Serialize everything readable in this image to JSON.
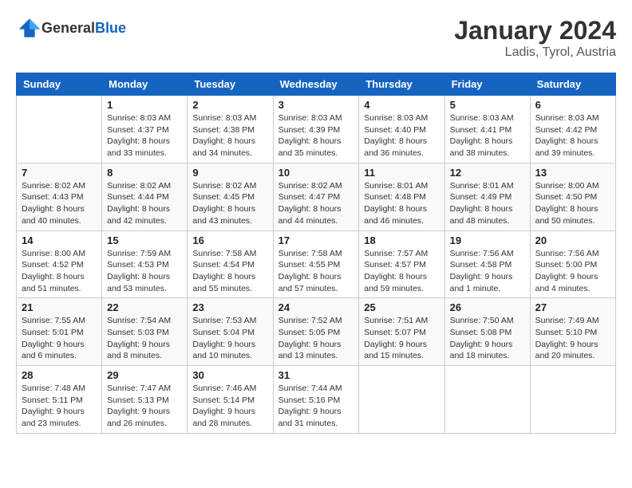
{
  "logo": {
    "text_general": "General",
    "text_blue": "Blue"
  },
  "header": {
    "month": "January 2024",
    "location": "Ladis, Tyrol, Austria"
  },
  "weekdays": [
    "Sunday",
    "Monday",
    "Tuesday",
    "Wednesday",
    "Thursday",
    "Friday",
    "Saturday"
  ],
  "weeks": [
    [
      {
        "day": "",
        "sunrise": "",
        "sunset": "",
        "daylight": ""
      },
      {
        "day": "1",
        "sunrise": "Sunrise: 8:03 AM",
        "sunset": "Sunset: 4:37 PM",
        "daylight": "Daylight: 8 hours and 33 minutes."
      },
      {
        "day": "2",
        "sunrise": "Sunrise: 8:03 AM",
        "sunset": "Sunset: 4:38 PM",
        "daylight": "Daylight: 8 hours and 34 minutes."
      },
      {
        "day": "3",
        "sunrise": "Sunrise: 8:03 AM",
        "sunset": "Sunset: 4:39 PM",
        "daylight": "Daylight: 8 hours and 35 minutes."
      },
      {
        "day": "4",
        "sunrise": "Sunrise: 8:03 AM",
        "sunset": "Sunset: 4:40 PM",
        "daylight": "Daylight: 8 hours and 36 minutes."
      },
      {
        "day": "5",
        "sunrise": "Sunrise: 8:03 AM",
        "sunset": "Sunset: 4:41 PM",
        "daylight": "Daylight: 8 hours and 38 minutes."
      },
      {
        "day": "6",
        "sunrise": "Sunrise: 8:03 AM",
        "sunset": "Sunset: 4:42 PM",
        "daylight": "Daylight: 8 hours and 39 minutes."
      }
    ],
    [
      {
        "day": "7",
        "sunrise": "Sunrise: 8:02 AM",
        "sunset": "Sunset: 4:43 PM",
        "daylight": "Daylight: 8 hours and 40 minutes."
      },
      {
        "day": "8",
        "sunrise": "Sunrise: 8:02 AM",
        "sunset": "Sunset: 4:44 PM",
        "daylight": "Daylight: 8 hours and 42 minutes."
      },
      {
        "day": "9",
        "sunrise": "Sunrise: 8:02 AM",
        "sunset": "Sunset: 4:45 PM",
        "daylight": "Daylight: 8 hours and 43 minutes."
      },
      {
        "day": "10",
        "sunrise": "Sunrise: 8:02 AM",
        "sunset": "Sunset: 4:47 PM",
        "daylight": "Daylight: 8 hours and 44 minutes."
      },
      {
        "day": "11",
        "sunrise": "Sunrise: 8:01 AM",
        "sunset": "Sunset: 4:48 PM",
        "daylight": "Daylight: 8 hours and 46 minutes."
      },
      {
        "day": "12",
        "sunrise": "Sunrise: 8:01 AM",
        "sunset": "Sunset: 4:49 PM",
        "daylight": "Daylight: 8 hours and 48 minutes."
      },
      {
        "day": "13",
        "sunrise": "Sunrise: 8:00 AM",
        "sunset": "Sunset: 4:50 PM",
        "daylight": "Daylight: 8 hours and 50 minutes."
      }
    ],
    [
      {
        "day": "14",
        "sunrise": "Sunrise: 8:00 AM",
        "sunset": "Sunset: 4:52 PM",
        "daylight": "Daylight: 8 hours and 51 minutes."
      },
      {
        "day": "15",
        "sunrise": "Sunrise: 7:59 AM",
        "sunset": "Sunset: 4:53 PM",
        "daylight": "Daylight: 8 hours and 53 minutes."
      },
      {
        "day": "16",
        "sunrise": "Sunrise: 7:58 AM",
        "sunset": "Sunset: 4:54 PM",
        "daylight": "Daylight: 8 hours and 55 minutes."
      },
      {
        "day": "17",
        "sunrise": "Sunrise: 7:58 AM",
        "sunset": "Sunset: 4:55 PM",
        "daylight": "Daylight: 8 hours and 57 minutes."
      },
      {
        "day": "18",
        "sunrise": "Sunrise: 7:57 AM",
        "sunset": "Sunset: 4:57 PM",
        "daylight": "Daylight: 8 hours and 59 minutes."
      },
      {
        "day": "19",
        "sunrise": "Sunrise: 7:56 AM",
        "sunset": "Sunset: 4:58 PM",
        "daylight": "Daylight: 9 hours and 1 minute."
      },
      {
        "day": "20",
        "sunrise": "Sunrise: 7:56 AM",
        "sunset": "Sunset: 5:00 PM",
        "daylight": "Daylight: 9 hours and 4 minutes."
      }
    ],
    [
      {
        "day": "21",
        "sunrise": "Sunrise: 7:55 AM",
        "sunset": "Sunset: 5:01 PM",
        "daylight": "Daylight: 9 hours and 6 minutes."
      },
      {
        "day": "22",
        "sunrise": "Sunrise: 7:54 AM",
        "sunset": "Sunset: 5:03 PM",
        "daylight": "Daylight: 9 hours and 8 minutes."
      },
      {
        "day": "23",
        "sunrise": "Sunrise: 7:53 AM",
        "sunset": "Sunset: 5:04 PM",
        "daylight": "Daylight: 9 hours and 10 minutes."
      },
      {
        "day": "24",
        "sunrise": "Sunrise: 7:52 AM",
        "sunset": "Sunset: 5:05 PM",
        "daylight": "Daylight: 9 hours and 13 minutes."
      },
      {
        "day": "25",
        "sunrise": "Sunrise: 7:51 AM",
        "sunset": "Sunset: 5:07 PM",
        "daylight": "Daylight: 9 hours and 15 minutes."
      },
      {
        "day": "26",
        "sunrise": "Sunrise: 7:50 AM",
        "sunset": "Sunset: 5:08 PM",
        "daylight": "Daylight: 9 hours and 18 minutes."
      },
      {
        "day": "27",
        "sunrise": "Sunrise: 7:49 AM",
        "sunset": "Sunset: 5:10 PM",
        "daylight": "Daylight: 9 hours and 20 minutes."
      }
    ],
    [
      {
        "day": "28",
        "sunrise": "Sunrise: 7:48 AM",
        "sunset": "Sunset: 5:11 PM",
        "daylight": "Daylight: 9 hours and 23 minutes."
      },
      {
        "day": "29",
        "sunrise": "Sunrise: 7:47 AM",
        "sunset": "Sunset: 5:13 PM",
        "daylight": "Daylight: 9 hours and 26 minutes."
      },
      {
        "day": "30",
        "sunrise": "Sunrise: 7:46 AM",
        "sunset": "Sunset: 5:14 PM",
        "daylight": "Daylight: 9 hours and 28 minutes."
      },
      {
        "day": "31",
        "sunrise": "Sunrise: 7:44 AM",
        "sunset": "Sunset: 5:16 PM",
        "daylight": "Daylight: 9 hours and 31 minutes."
      },
      {
        "day": "",
        "sunrise": "",
        "sunset": "",
        "daylight": ""
      },
      {
        "day": "",
        "sunrise": "",
        "sunset": "",
        "daylight": ""
      },
      {
        "day": "",
        "sunrise": "",
        "sunset": "",
        "daylight": ""
      }
    ]
  ]
}
